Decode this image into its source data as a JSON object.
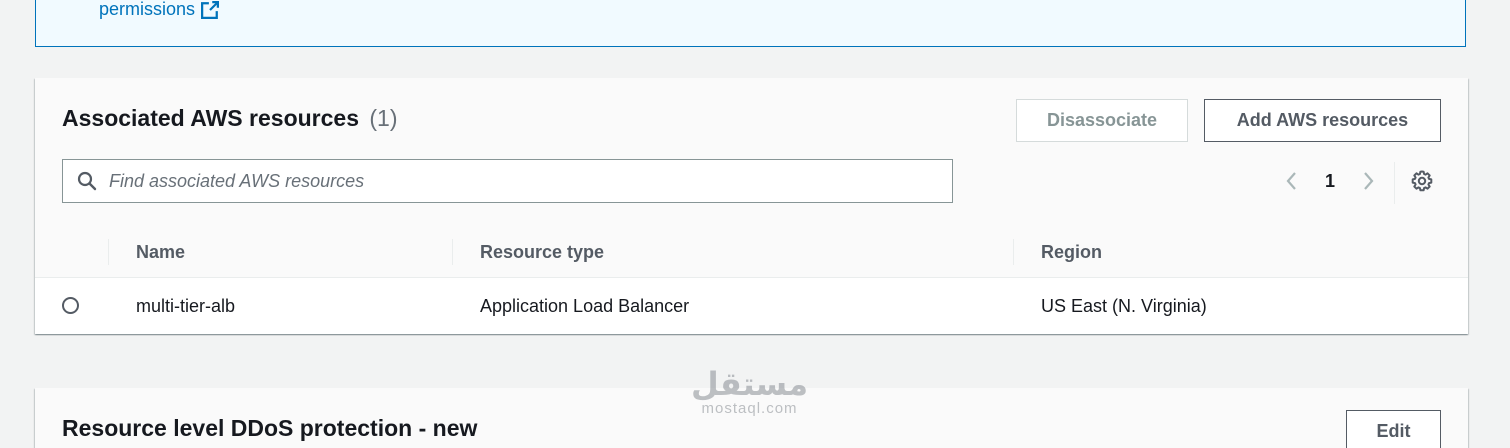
{
  "info_box": {
    "link_text": "permissions"
  },
  "associated_resources": {
    "title": "Associated AWS resources",
    "count": "(1)",
    "disassociate_label": "Disassociate",
    "add_label": "Add AWS resources",
    "search": {
      "placeholder": "Find associated AWS resources",
      "value": ""
    },
    "pagination": {
      "current_page": "1"
    },
    "table": {
      "columns": [
        "Name",
        "Resource type",
        "Region"
      ],
      "rows": [
        {
          "name": "multi-tier-alb",
          "resource_type": "Application Load Balancer",
          "region": "US East (N. Virginia)"
        }
      ]
    }
  },
  "ddos_panel": {
    "title": "Resource level DDoS protection - new",
    "edit_label": "Edit"
  },
  "watermark": {
    "arabic": "مستقل",
    "latin": "mostaql.com"
  },
  "icons": {
    "external_link": "external-link-icon",
    "search": "search-icon",
    "prev": "chevron-left-icon",
    "next": "chevron-right-icon",
    "settings": "gear-icon"
  },
  "colors": {
    "link": "#0073bb",
    "info_bg": "#f1faff",
    "text": "#16191f",
    "muted": "#687078",
    "disabled": "#879596"
  }
}
